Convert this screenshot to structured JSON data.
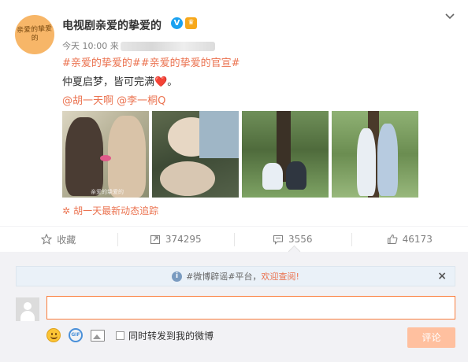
{
  "post": {
    "avatar_text": "亲爱的挚爱的",
    "author": "电视剧亲爱的挚爱的",
    "verified_badge": "V",
    "crown_badge": "♛",
    "time": "今天 10:00 来",
    "topics": "#亲爱的挚爱的##亲爱的挚爱的官宣#",
    "content_text": "仲夏启梦，皆可完满",
    "content_emoji": "❤️",
    "content_end": "。",
    "mentions": "@胡一天啊 @李一桐Q",
    "photo_watermark": "亲爱的挚爱的",
    "promo_icon": "✲",
    "promo_text": "胡一天最新动态追踪"
  },
  "actions": {
    "favorite_label": "收藏",
    "repost_count": "374295",
    "comment_count": "3556",
    "like_count": "46173"
  },
  "comment_box": {
    "notice_prefix": "#微博辟谣#平台，",
    "notice_link": "欢迎查阅",
    "notice_suffix": "!",
    "notice_close": "×",
    "input_value": "",
    "input_placeholder": "",
    "repost_label": "同时转发到我的微博",
    "submit_label": "评论"
  },
  "colors": {
    "accent": "#eb7350",
    "input_border": "#fa7d3c",
    "submit_bg": "#ffc09f",
    "verified": "#1aa1f0"
  },
  "icons": [
    "chevron-down-icon",
    "verified-icon",
    "crown-icon",
    "star-icon",
    "repost-icon",
    "comment-icon",
    "like-icon",
    "info-icon",
    "close-icon",
    "emoji-icon",
    "gif-icon",
    "image-icon"
  ]
}
